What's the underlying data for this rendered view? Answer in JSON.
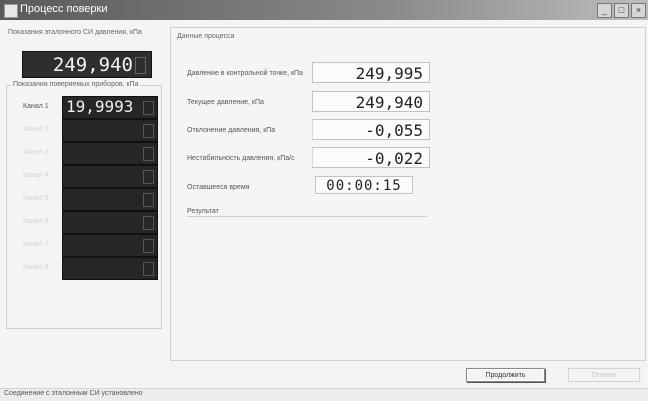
{
  "window": {
    "title": "Процесс поверки",
    "controls": [
      "_",
      "□",
      "×"
    ]
  },
  "left_panel": {
    "reference_label": "Показания эталонного СИ давления, кПа",
    "reference_value": "249,940",
    "devices_label": "Показания поверяемых приборов, кПа",
    "devices": [
      {
        "label": "Канал 1",
        "value": "19,9993"
      },
      {
        "label": "Канал 2",
        "value": ""
      },
      {
        "label": "Канал 3",
        "value": ""
      },
      {
        "label": "Канал 4",
        "value": ""
      },
      {
        "label": "Канал 5",
        "value": ""
      },
      {
        "label": "Канал 6",
        "value": ""
      },
      {
        "label": "Канал 7",
        "value": ""
      },
      {
        "label": "Канал 8",
        "value": ""
      }
    ]
  },
  "right_panel": {
    "title": "Данные процесса",
    "params": [
      {
        "label": "Давление в контрольной точке, кПа",
        "value": "249,995"
      },
      {
        "label": "Текущее давление, кПа",
        "value": "249,940"
      },
      {
        "label": "Отклонение давления, кПа",
        "value": "-0,055"
      },
      {
        "label": "Нестабильность давления, кПа/с",
        "value": "-0,022"
      },
      {
        "label": "Оставшееся время",
        "value": "00:00:15"
      }
    ],
    "result_label": "Результат"
  },
  "buttons": {
    "primary": "Продолжить",
    "secondary": "Отмена"
  },
  "status": {
    "text": "Соединение с эталонным СИ установлено"
  }
}
